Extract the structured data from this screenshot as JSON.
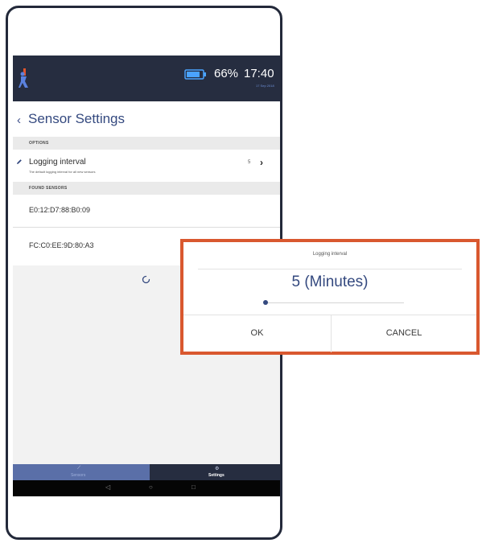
{
  "status_bar": {
    "battery_percent": "66%",
    "time": "17:40",
    "time_sub": "17 Sep 2018"
  },
  "header": {
    "back_glyph": "‹",
    "title": "Sensor Settings"
  },
  "sections": {
    "options_header": "OPTIONS",
    "logging_interval": {
      "title": "Logging interval",
      "subtitle": "The default logging interval for all new sensors",
      "value": "5"
    },
    "found_sensors_header": "FOUND SENSORS",
    "sensors": [
      "E0:12:D7:88:B0:09",
      "FC:C0:EE:9D:80:A3"
    ]
  },
  "bottom_nav": {
    "sensors_label": "Sensors",
    "settings_label": "Settings"
  },
  "dialog": {
    "title": "Logging interval",
    "value_text": "5 (Minutes)",
    "slider_fraction": 0.0,
    "ok_label": "OK",
    "cancel_label": "CANCEL"
  },
  "colors": {
    "accent": "#34497f",
    "highlight_border": "#d9582f",
    "status_bar": "#262d40"
  },
  "icons": [
    "app-logo-icon",
    "battery-icon",
    "pencil-icon",
    "chevron-right-icon",
    "spinner-icon",
    "graph-icon",
    "gear-icon",
    "back-triangle-icon",
    "home-circle-icon",
    "recents-square-icon"
  ]
}
